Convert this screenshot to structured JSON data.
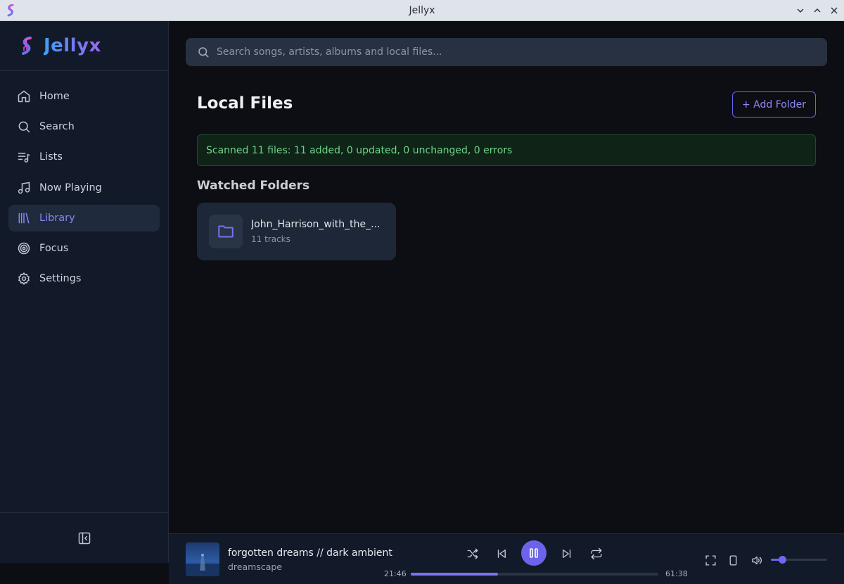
{
  "window": {
    "title": "Jellyx"
  },
  "brand": {
    "name": "Jellyx"
  },
  "sidebar": {
    "items": [
      {
        "label": "Home",
        "icon": "home-icon"
      },
      {
        "label": "Search",
        "icon": "search-icon"
      },
      {
        "label": "Lists",
        "icon": "list-music-icon"
      },
      {
        "label": "Now Playing",
        "icon": "music-note-icon"
      },
      {
        "label": "Library",
        "icon": "library-icon",
        "active": true
      },
      {
        "label": "Focus",
        "icon": "target-icon"
      },
      {
        "label": "Settings",
        "icon": "gear-icon"
      }
    ]
  },
  "search": {
    "placeholder": "Search songs, artists, albums and local files..."
  },
  "page": {
    "title": "Local Files",
    "add_folder_label": "+ Add Folder",
    "scan_status": "Scanned 11 files: 11 added, 0 updated, 0 unchanged, 0 errors",
    "watched_title": "Watched Folders",
    "folders": [
      {
        "name": "John_Harrison_with_the_...",
        "count": "11 tracks"
      }
    ]
  },
  "player": {
    "track_title": "forgotten dreams // dark ambient",
    "artist": "dreamscape",
    "elapsed": "21:46",
    "duration": "61:38",
    "progress": 0.353,
    "volume": 0.2
  },
  "colors": {
    "accent": "#6c63ea",
    "sidebar_bg": "#121a2a",
    "main_bg": "#0d0e14",
    "success_text": "#6fd48b"
  }
}
